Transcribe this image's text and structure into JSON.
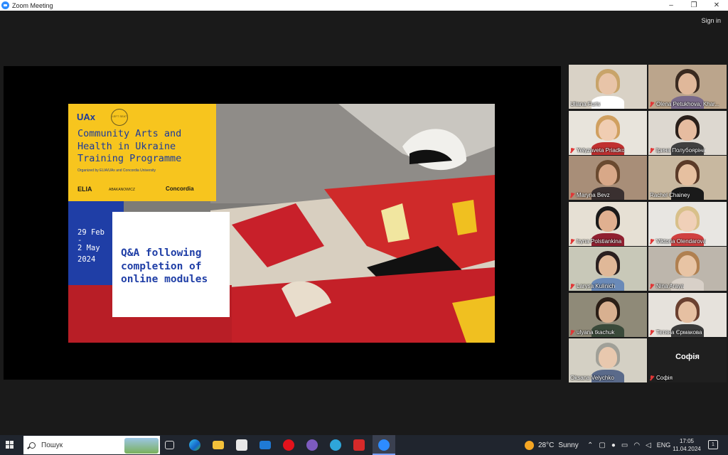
{
  "window": {
    "title": "Zoom Meeting",
    "controls": {
      "minimize": "–",
      "restore": "❐",
      "close": "✕"
    }
  },
  "header": {
    "sign_in": "Sign in"
  },
  "slide": {
    "brand": "UAx",
    "seal_text": "LEFT SEAT",
    "title": "Community Arts and Health in Ukraine Training Programme",
    "organized_by": "Organized by ELIA/UAx and Concordia University",
    "logos": {
      "elia": "ELIA",
      "abakanowicz": "ABAKANOWICZ",
      "concordia": "Concordia"
    },
    "dates": [
      "29 Feb",
      "-",
      "2 May",
      "2024"
    ],
    "qa_text": "Q&A following completion of online modules"
  },
  "participants": [
    {
      "name": "Uliana Furiv",
      "muted": false,
      "active": true
    },
    {
      "name": "Olena Petukhova, Khar...",
      "muted": true,
      "active": false
    },
    {
      "name": "Yelyzaveta Priadko",
      "muted": true,
      "active": false
    },
    {
      "name": "Ірина Полубояріна",
      "muted": true,
      "active": false
    },
    {
      "name": "Maryna Bevz",
      "muted": true,
      "active": false
    },
    {
      "name": "Rachel Chainey",
      "muted": false,
      "active": false
    },
    {
      "name": "Iryna Polstiankina",
      "muted": true,
      "active": false
    },
    {
      "name": "Viktoria Olendarova",
      "muted": true,
      "active": false
    },
    {
      "name": "Larysa Kulinich",
      "muted": true,
      "active": false
    },
    {
      "name": "Nina Araya",
      "muted": true,
      "active": false
    },
    {
      "name": "ulyana tkachuk",
      "muted": true,
      "active": false
    },
    {
      "name": "Тетяна Єрмакова",
      "muted": true,
      "active": false
    },
    {
      "name": "Oksana Velychko",
      "muted": false,
      "active": false
    },
    {
      "name": "Софія",
      "muted": true,
      "active": false,
      "video_off_name": "Софія"
    }
  ],
  "taskbar": {
    "search_placeholder": "Пошук",
    "weather_temp": "28°C",
    "weather_text": "Sunny",
    "language": "ENG",
    "time": "17:05",
    "date": "11.04.2024",
    "notification_count": "1"
  }
}
